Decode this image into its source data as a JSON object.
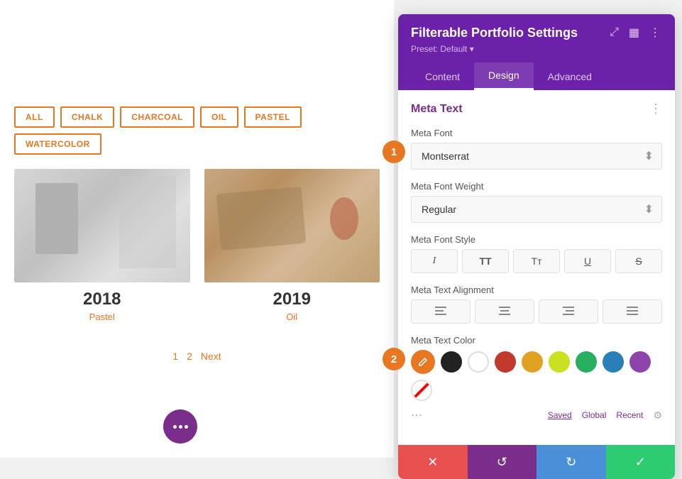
{
  "portfolio": {
    "filters": [
      "ALL",
      "CHALK",
      "CHARCOAL",
      "OIL",
      "PASTEL",
      "WATERCOLOR"
    ],
    "items": [
      {
        "year": "2018",
        "category": "Pastel"
      },
      {
        "year": "2019",
        "category": "Oil"
      }
    ],
    "pagination": {
      "pages": [
        "1",
        "2"
      ],
      "next_label": "Next"
    }
  },
  "settings_panel": {
    "title": "Filterable Portfolio Settings",
    "preset_label": "Preset: Default",
    "preset_arrow": "▾",
    "tabs": [
      {
        "id": "content",
        "label": "Content"
      },
      {
        "id": "design",
        "label": "Design",
        "active": true
      },
      {
        "id": "advanced",
        "label": "Advanced"
      }
    ],
    "icons": {
      "expand": "⤢",
      "grid": "▦",
      "more": "⋮"
    },
    "section": {
      "title": "Meta Text",
      "menu_icon": "⋮"
    },
    "meta_font": {
      "label": "Meta Font",
      "value": "Montserrat"
    },
    "meta_font_weight": {
      "label": "Meta Font Weight",
      "value": "Regular"
    },
    "meta_font_style": {
      "label": "Meta Font Style",
      "buttons": [
        {
          "id": "italic",
          "display": "I"
        },
        {
          "id": "bold",
          "display": "TT"
        },
        {
          "id": "caps",
          "display": "Tт"
        },
        {
          "id": "underline",
          "display": "U"
        },
        {
          "id": "strikethrough",
          "display": "S"
        }
      ]
    },
    "meta_text_alignment": {
      "label": "Meta Text Alignment",
      "buttons": [
        {
          "id": "left",
          "display": "≡"
        },
        {
          "id": "center",
          "display": "≡"
        },
        {
          "id": "right",
          "display": "≡"
        },
        {
          "id": "justify",
          "display": "≡"
        }
      ]
    },
    "meta_text_color": {
      "label": "Meta Text Color",
      "swatches": [
        {
          "id": "orange",
          "color": "#e87722",
          "active": true
        },
        {
          "id": "black",
          "color": "#222222"
        },
        {
          "id": "white",
          "color": "#ffffff"
        },
        {
          "id": "red",
          "color": "#c0392b"
        },
        {
          "id": "yellow",
          "color": "#e0a020"
        },
        {
          "id": "lime",
          "color": "#c8e020"
        },
        {
          "id": "green",
          "color": "#27ae60"
        },
        {
          "id": "blue",
          "color": "#2980b9"
        },
        {
          "id": "purple",
          "color": "#8e44ad"
        },
        {
          "id": "transparent",
          "color": "transparent"
        }
      ],
      "color_tabs": [
        {
          "id": "saved",
          "label": "Saved",
          "active": true
        },
        {
          "id": "global",
          "label": "Global"
        },
        {
          "id": "recent",
          "label": "Recent"
        }
      ],
      "more_icon": "⋯",
      "gear_icon": "⚙"
    },
    "action_bar": {
      "cancel_icon": "✕",
      "undo_icon": "↺",
      "redo_icon": "↻",
      "save_icon": "✓"
    },
    "step_badges": [
      {
        "id": "1",
        "label": "1"
      },
      {
        "id": "2",
        "label": "2"
      }
    ]
  }
}
